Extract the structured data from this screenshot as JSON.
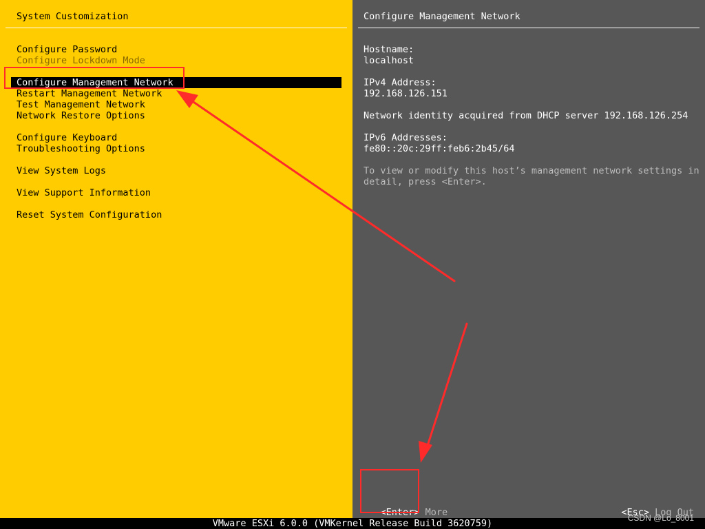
{
  "left": {
    "title": "System Customization",
    "menu": {
      "configure_password": "Configure Password",
      "configure_lockdown_mode": "Configure Lockdown Mode",
      "configure_management_network": "Configure Management Network",
      "restart_management_network": "Restart Management Network",
      "test_management_network": "Test Management Network",
      "network_restore_options": "Network Restore Options",
      "configure_keyboard": "Configure Keyboard",
      "troubleshooting_options": "Troubleshooting Options",
      "view_system_logs": "View System Logs",
      "view_support_information": "View Support Information",
      "reset_system_configuration": "Reset System Configuration"
    },
    "selected_item": "Configure Management Network"
  },
  "right": {
    "title": "Configure Management Network",
    "hostname_label": "Hostname:",
    "hostname_value": "localhost",
    "ipv4_label": "IPv4 Address:",
    "ipv4_value": "192.168.126.151",
    "identity_text": "Network identity acquired from DHCP server 192.168.126.254",
    "ipv6_label": "IPv6 Addresses:",
    "ipv6_value": "fe80::20c:29ff:feb6:2b45/64",
    "help_line1": "To view or modify this host’s management network settings in",
    "help_line2": "detail, press <Enter>."
  },
  "keys": {
    "enter_key": "<Enter>",
    "enter_action": "More",
    "esc_key": "<Esc>",
    "esc_action": "Log Out"
  },
  "footer": {
    "text": "VMware ESXi 6.0.0 (VMKernel Release Build 3620759)"
  },
  "watermark": "CSDN @Lo_8001",
  "colors": {
    "left_background": "#ffcc00",
    "right_background": "#575757",
    "selection_background": "#000000",
    "annotation": "#ff2a2a"
  }
}
